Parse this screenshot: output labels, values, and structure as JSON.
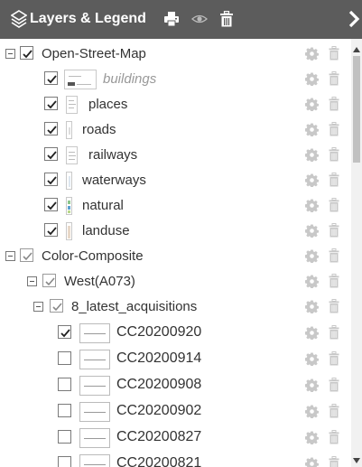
{
  "header": {
    "title": "Layers & Legend",
    "background": "#5c5c5c",
    "icons": [
      "layers-icon",
      "print-icon",
      "eye-icon",
      "trash-icon",
      "chevron-right-icon"
    ]
  },
  "rows": [
    {
      "name": "layer-group-open-street-map",
      "label": "Open-Street-Map"
    },
    {
      "name": "layer-buildings",
      "label": "buildings"
    },
    {
      "name": "layer-places",
      "label": "places"
    },
    {
      "name": "layer-roads",
      "label": "roads"
    },
    {
      "name": "layer-railways",
      "label": "railways"
    },
    {
      "name": "layer-waterways",
      "label": "waterways"
    },
    {
      "name": "layer-natural",
      "label": "natural"
    },
    {
      "name": "layer-landuse",
      "label": "landuse"
    },
    {
      "name": "layer-group-color-composite",
      "label": "Color-Composite"
    },
    {
      "name": "layer-group-west",
      "label": "West(A073)"
    },
    {
      "name": "layer-group-8-latest-acquisitions",
      "label": "8_latest_acquisitions"
    },
    {
      "name": "layer-cc20200920",
      "label": "CC20200920",
      "checked": true
    },
    {
      "name": "layer-cc20200914",
      "label": "CC20200914",
      "checked": false
    },
    {
      "name": "layer-cc20200908",
      "label": "CC20200908",
      "checked": false
    },
    {
      "name": "layer-cc20200902",
      "label": "CC20200902",
      "checked": false
    },
    {
      "name": "layer-cc20200827",
      "label": "CC20200827",
      "checked": false
    },
    {
      "name": "layer-cc20200821",
      "label": "CC20200821",
      "checked": false
    }
  ],
  "icons": {
    "row_actions": [
      "gear-icon",
      "trash-icon"
    ],
    "action_color": "#c8c8c8",
    "checkmark_color": "#222222"
  }
}
